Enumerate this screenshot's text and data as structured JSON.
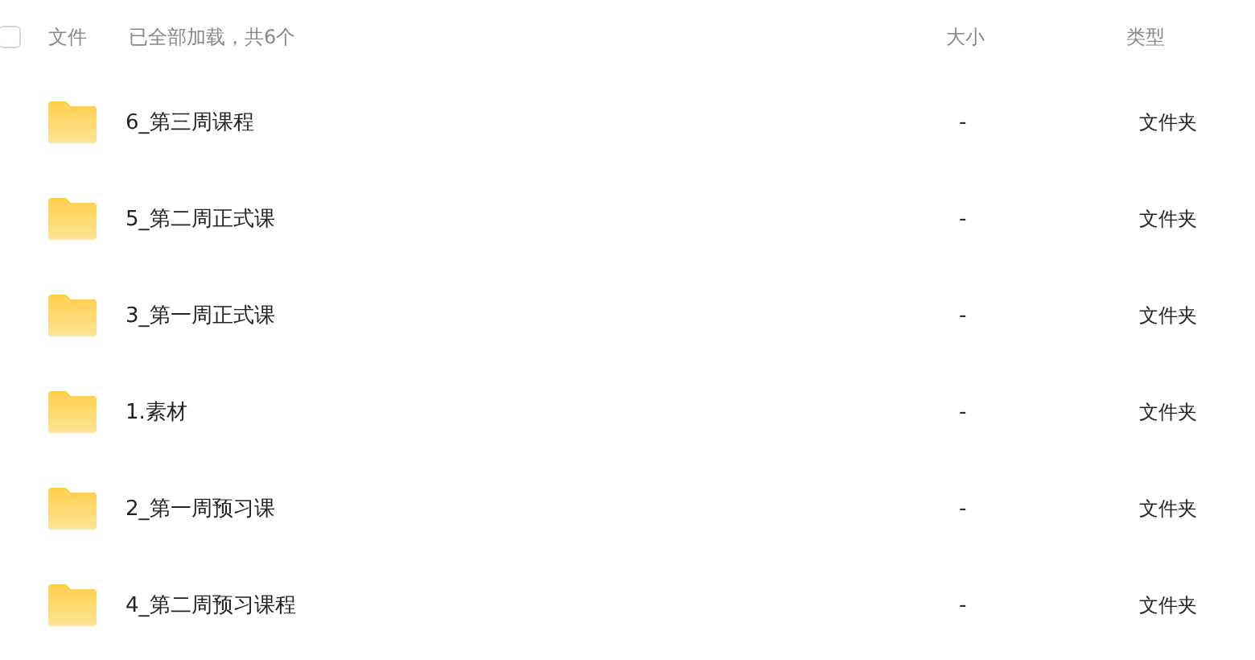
{
  "header": {
    "checked": false,
    "name_label": "文件",
    "status": "已全部加载，共6个",
    "size_label": "大小",
    "type_label": "类型"
  },
  "rows": [
    {
      "name": "6_第三周课程",
      "size": "-",
      "type": "文件夹"
    },
    {
      "name": "5_第二周正式课",
      "size": "-",
      "type": "文件夹"
    },
    {
      "name": "3_第一周正式课",
      "size": "-",
      "type": "文件夹"
    },
    {
      "name": "1.素材",
      "size": "-",
      "type": "文件夹"
    },
    {
      "name": "2_第一周预习课",
      "size": "-",
      "type": "文件夹"
    },
    {
      "name": "4_第二周预习课程",
      "size": "-",
      "type": "文件夹"
    }
  ]
}
